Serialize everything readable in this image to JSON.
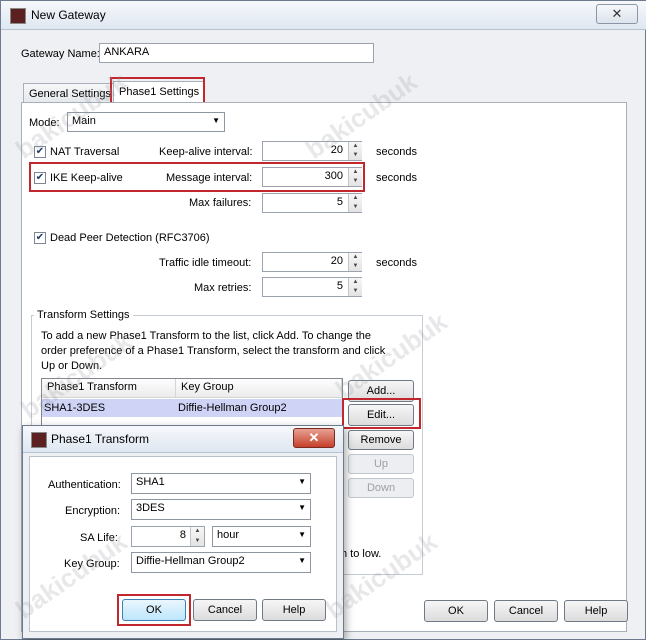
{
  "window": {
    "title": "New Gateway"
  },
  "gateway": {
    "name_label": "Gateway Name:",
    "name_value": "ANKARA"
  },
  "tabs": [
    {
      "label": "General Settings"
    },
    {
      "label": "Phase1 Settings"
    }
  ],
  "phase1": {
    "mode_label": "Mode:",
    "mode_value": "Main",
    "nat_traversal": {
      "label": "NAT Traversal",
      "checked": true
    },
    "keepalive_interval": {
      "label": "Keep-alive interval:",
      "value": "20",
      "unit": "seconds"
    },
    "ike_keepalive": {
      "label": "IKE Keep-alive",
      "checked": true
    },
    "message_interval": {
      "label": "Message interval:",
      "value": "300",
      "unit": "seconds"
    },
    "max_failures": {
      "label": "Max failures:",
      "value": "5"
    },
    "dpd": {
      "label": "Dead Peer Detection (RFC3706)",
      "checked": true
    },
    "traffic_idle_timeout": {
      "label": "Traffic idle timeout:",
      "value": "20",
      "unit": "seconds"
    },
    "max_retries": {
      "label": "Max retries:",
      "value": "5"
    }
  },
  "transform_settings": {
    "title": "Transform Settings",
    "description": "To add a new Phase1 Transform to the list, click Add. To change the order preference of a Phase1 Transform, select the transform and click Up or Down.",
    "columns": [
      "Phase1 Transform",
      "Key Group"
    ],
    "rows": [
      {
        "transform": "SHA1-3DES",
        "key_group": "Diffie-Hellman Group2"
      }
    ],
    "buttons": {
      "add": "Add...",
      "edit": "Edit...",
      "remove": "Remove",
      "up": "Up",
      "down": "Down"
    },
    "footer_partial": "h to low."
  },
  "main_buttons": {
    "ok": "OK",
    "cancel": "Cancel",
    "help": "Help"
  },
  "dialog": {
    "title": "Phase1 Transform",
    "authentication": {
      "label": "Authentication:",
      "value": "SHA1"
    },
    "encryption": {
      "label": "Encryption:",
      "value": "3DES"
    },
    "sa_life": {
      "label": "SA Life:",
      "value": "8",
      "unit": "hour"
    },
    "key_group": {
      "label": "Key Group:",
      "value": "Diffie-Hellman Group2"
    },
    "buttons": {
      "ok": "OK",
      "cancel": "Cancel",
      "help": "Help"
    }
  },
  "watermark": "bakicubuk",
  "colors": {
    "highlight_box": "#c1272d",
    "selected_row": "#cfd3f5",
    "default_button": "#3c7fb1"
  }
}
